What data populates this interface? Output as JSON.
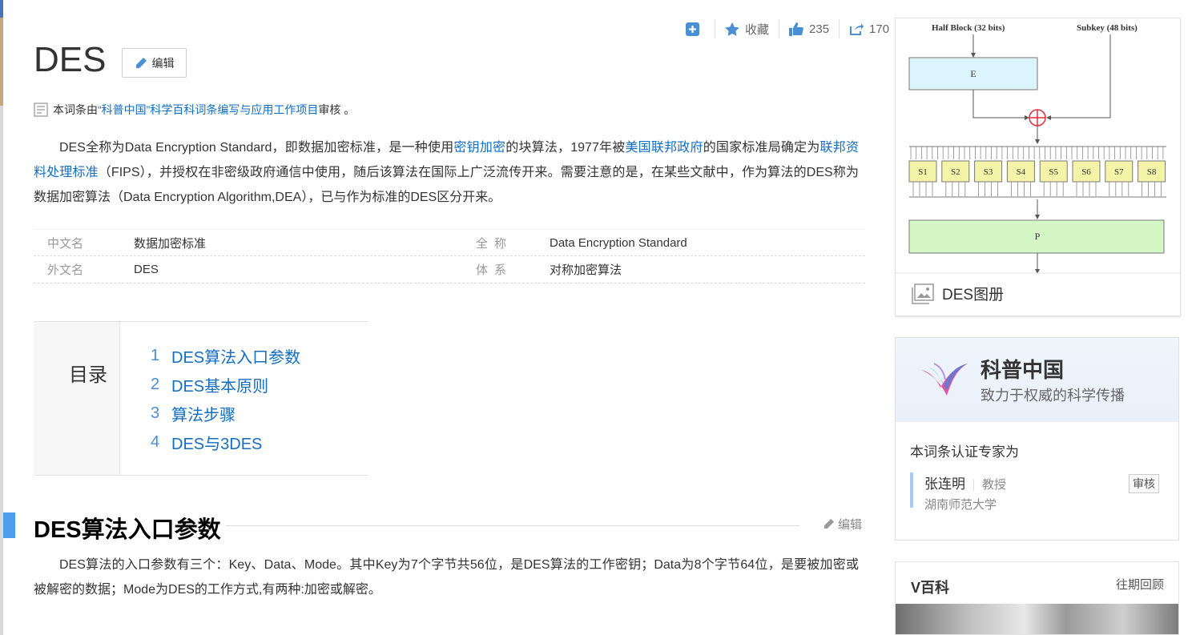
{
  "toolbar": {
    "favorite_label": "收藏",
    "like_count": "235",
    "share_count": "170"
  },
  "title": "DES",
  "edit_label": "编辑",
  "review": {
    "prefix": "本词条由",
    "link": "“科普中国”科学百科词条编写与应用工作项目",
    "suffix": " 审核 。"
  },
  "intro": {
    "p1": "DES全称为Data Encryption Standard，即数据加密标准，是一种使用",
    "l1": "密钥加密",
    "p2": "的块算法，1977年被",
    "l2": "美国联邦政府",
    "p3": "的国家标准局确定为",
    "l3": "联邦资料处理标准",
    "p4": "（FIPS），并授权在非密级政府通信中使用，随后该算法在国际上广泛流传开来。需要注意的是，在某些文献中，作为算法的DES称为数据加密算法（Data Encryption Algorithm,DEA），已与作为标准的DES区分开来。"
  },
  "info": {
    "rows": [
      {
        "k1": "中文名",
        "v1": "数据加密标准",
        "k2": "全称",
        "v2": "Data Encryption Standard"
      },
      {
        "k1": "外文名",
        "v1": "DES",
        "k2": "体系",
        "v2": "对称加密算法"
      }
    ]
  },
  "toc": {
    "label": "目录",
    "items": [
      {
        "num": "1",
        "text": "DES算法入口参数"
      },
      {
        "num": "2",
        "text": "DES基本原则"
      },
      {
        "num": "3",
        "text": "算法步骤"
      },
      {
        "num": "4",
        "text": "DES与3DES"
      }
    ]
  },
  "section1": {
    "title": "DES算法入口参数",
    "edit_label": "编辑",
    "body": "DES算法的入口参数有三个：Key、Data、Mode。其中Key为7个字节共56位，是DES算法的工作密钥；Data为8个字节64位，是要被加密或被解密的数据；Mode为DES的工作方式,有两种:加密或解密。"
  },
  "album": {
    "diagram": {
      "half_block": "Half Block (32 bits)",
      "subkey": "Subkey (48 bits)",
      "e_label": "E",
      "p_label": "P",
      "sboxes": [
        "S1",
        "S2",
        "S3",
        "S4",
        "S5",
        "S6",
        "S7",
        "S8"
      ]
    },
    "footer": "DES图册"
  },
  "expert": {
    "org": "科普中国",
    "slogan": "致力于权威的科学传播",
    "cert_title": "本词条认证专家为",
    "name": "张连明",
    "title": "教授",
    "school": "湖南师范大学",
    "badge": "审核"
  },
  "vbaike": {
    "title": "V百科",
    "more": "往期回顾"
  },
  "colors": {
    "link": "#136ec2",
    "accent": "#4f9cee",
    "e_box": "#dcf4fb",
    "p_box": "#d5f7c6",
    "sbox": "#f4f4a8",
    "xor": "#e0303a"
  }
}
